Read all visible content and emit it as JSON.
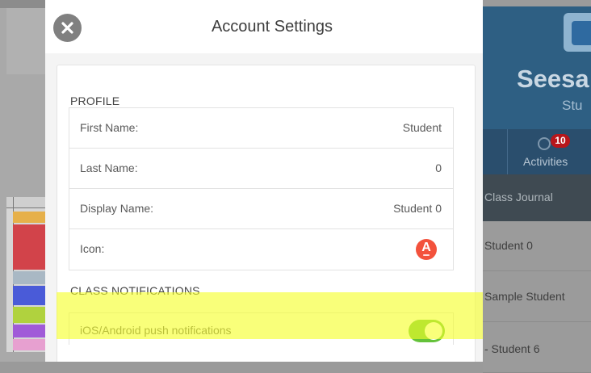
{
  "modal": {
    "title": "Account Settings",
    "close_icon": "close-x-icon",
    "profile_section": {
      "heading": "PROFILE",
      "fields": [
        {
          "label": "First Name:",
          "value": "Student"
        },
        {
          "label": "Last Name:",
          "value": "0"
        },
        {
          "label": "Display Name:",
          "value": "Student 0"
        },
        {
          "label": "Icon:",
          "icon": "student-avatar-icon",
          "letter": "A"
        }
      ]
    },
    "notifications_section": {
      "heading": "CLASS NOTIFICATIONS",
      "push": {
        "label": "iOS/Android push notifications",
        "enabled": true
      }
    }
  },
  "background_app": {
    "name": "Seesa",
    "subtitle": "Stu",
    "activities_tab": {
      "label": "Activities",
      "badge_count": "10",
      "icon": "lightbulb-icon"
    },
    "class_journal": "Class Journal",
    "students": [
      "Student 0",
      "Sample Student",
      "- Student 6"
    ]
  },
  "colors": {
    "toggle_on": "#64c23a",
    "avatar": "#f3523c",
    "badge": "#b8161b",
    "highlight": "#f6ff28",
    "app_header": "#2e5f83"
  }
}
